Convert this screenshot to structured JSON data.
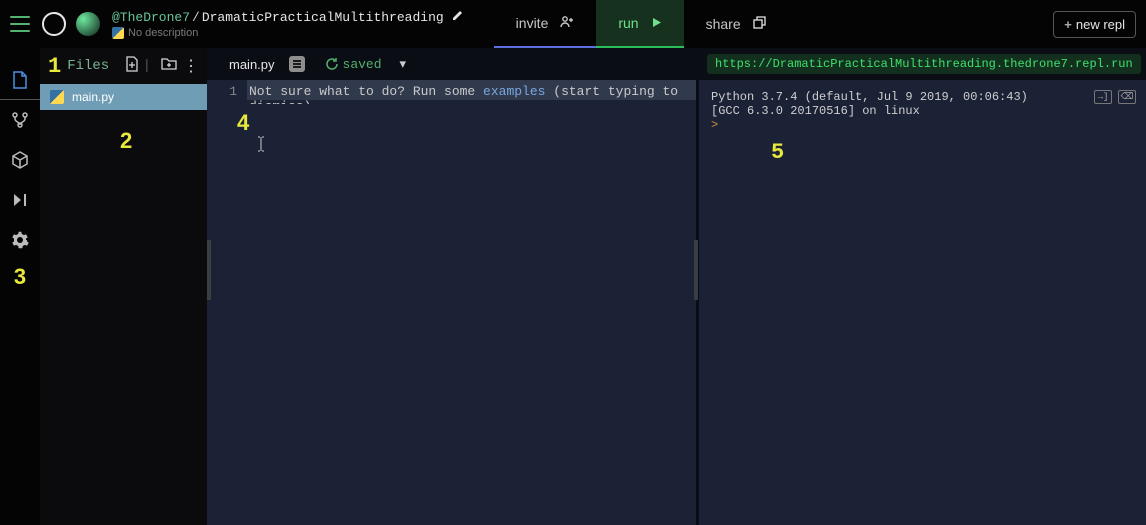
{
  "header": {
    "user": "@TheDrone7",
    "project": "DramaticPracticalMultithreading",
    "description": "No description",
    "tabs": {
      "invite": "invite",
      "run": "run",
      "share": "share"
    },
    "new_repl": "new repl"
  },
  "annotations": {
    "a1": "1",
    "a2": "2",
    "a3": "3",
    "a4": "4",
    "a5": "5"
  },
  "files": {
    "title": "Files",
    "items": [
      {
        "name": "main.py"
      }
    ]
  },
  "editor": {
    "filename": "main.py",
    "saved_label": "saved",
    "line_no": "1",
    "placeholder_pre": "Not sure what to do? Run some ",
    "placeholder_link": "examples",
    "placeholder_post": " (start typing to dismiss)"
  },
  "console": {
    "url": "https://DramaticPracticalMultithreading.thedrone7.repl.run",
    "line1": "Python 3.7.4 (default, Jul  9 2019, 00:06:43)",
    "line2": "[GCC 6.3.0 20170516] on linux",
    "prompt": ">"
  }
}
